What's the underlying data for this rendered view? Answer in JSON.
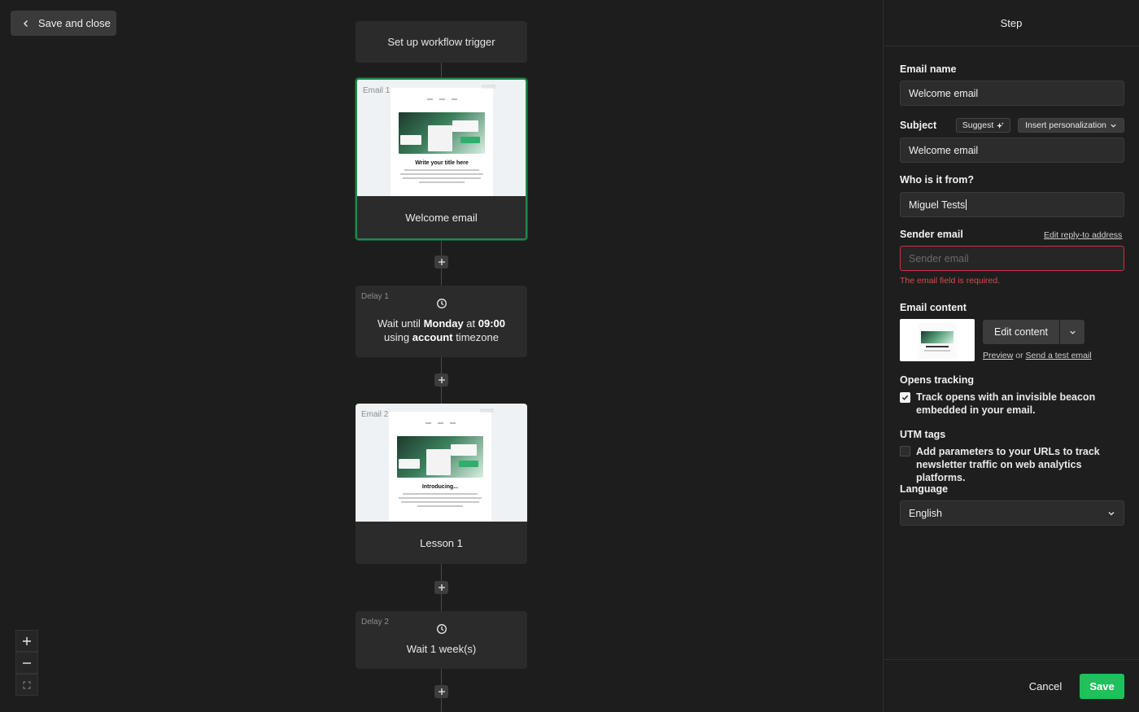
{
  "canvas": {
    "save_close_label": "Save and close",
    "trigger_label": "Set up workflow trigger",
    "nodes": [
      {
        "tag": "Email 1",
        "name": "Welcome email",
        "preview_title": "Write your title here"
      },
      {
        "tag": "Delay 1",
        "line1_prefix": "Wait until ",
        "line1_bold": "Monday",
        "line1_mid": " at ",
        "line1_time": "09:00",
        "line2_prefix": "using ",
        "line2_bold": "account",
        "line2_suffix": " timezone"
      },
      {
        "tag": "Email 2",
        "name": "Lesson 1",
        "preview_title": "Introducing..."
      },
      {
        "tag": "Delay 2",
        "text": "Wait 1 week(s)"
      }
    ]
  },
  "panel": {
    "title": "Step",
    "email_name_label": "Email name",
    "email_name_value": "Welcome email",
    "subject_label": "Subject",
    "suggest_label": "Suggest",
    "insert_personalization_label": "Insert personalization",
    "subject_value": "Welcome email",
    "from_label": "Who is it from?",
    "from_value": "Miguel Tests",
    "sender_email_label": "Sender email",
    "edit_reply_label": "Edit reply-to address",
    "sender_email_placeholder": "Sender email",
    "sender_email_error": "The email field is required.",
    "email_content_label": "Email content",
    "edit_content_label": "Edit content",
    "preview_link": "Preview",
    "or_text": " or ",
    "test_email_link": "Send a test email",
    "opens_tracking_label": "Opens tracking",
    "opens_tracking_text": "Track opens with an invisible beacon embedded in your email.",
    "opens_tracking_checked": true,
    "utm_label": "UTM tags",
    "utm_text": "Add parameters to your URLs to track newsletter traffic on web analytics platforms.",
    "utm_checked": false,
    "language_label": "Language",
    "language_value": "English",
    "cancel_label": "Cancel",
    "save_label": "Save"
  },
  "colors": {
    "accent_green": "#20c05c",
    "selected_border": "#1f8a4c",
    "error_red": "#e0474b"
  }
}
